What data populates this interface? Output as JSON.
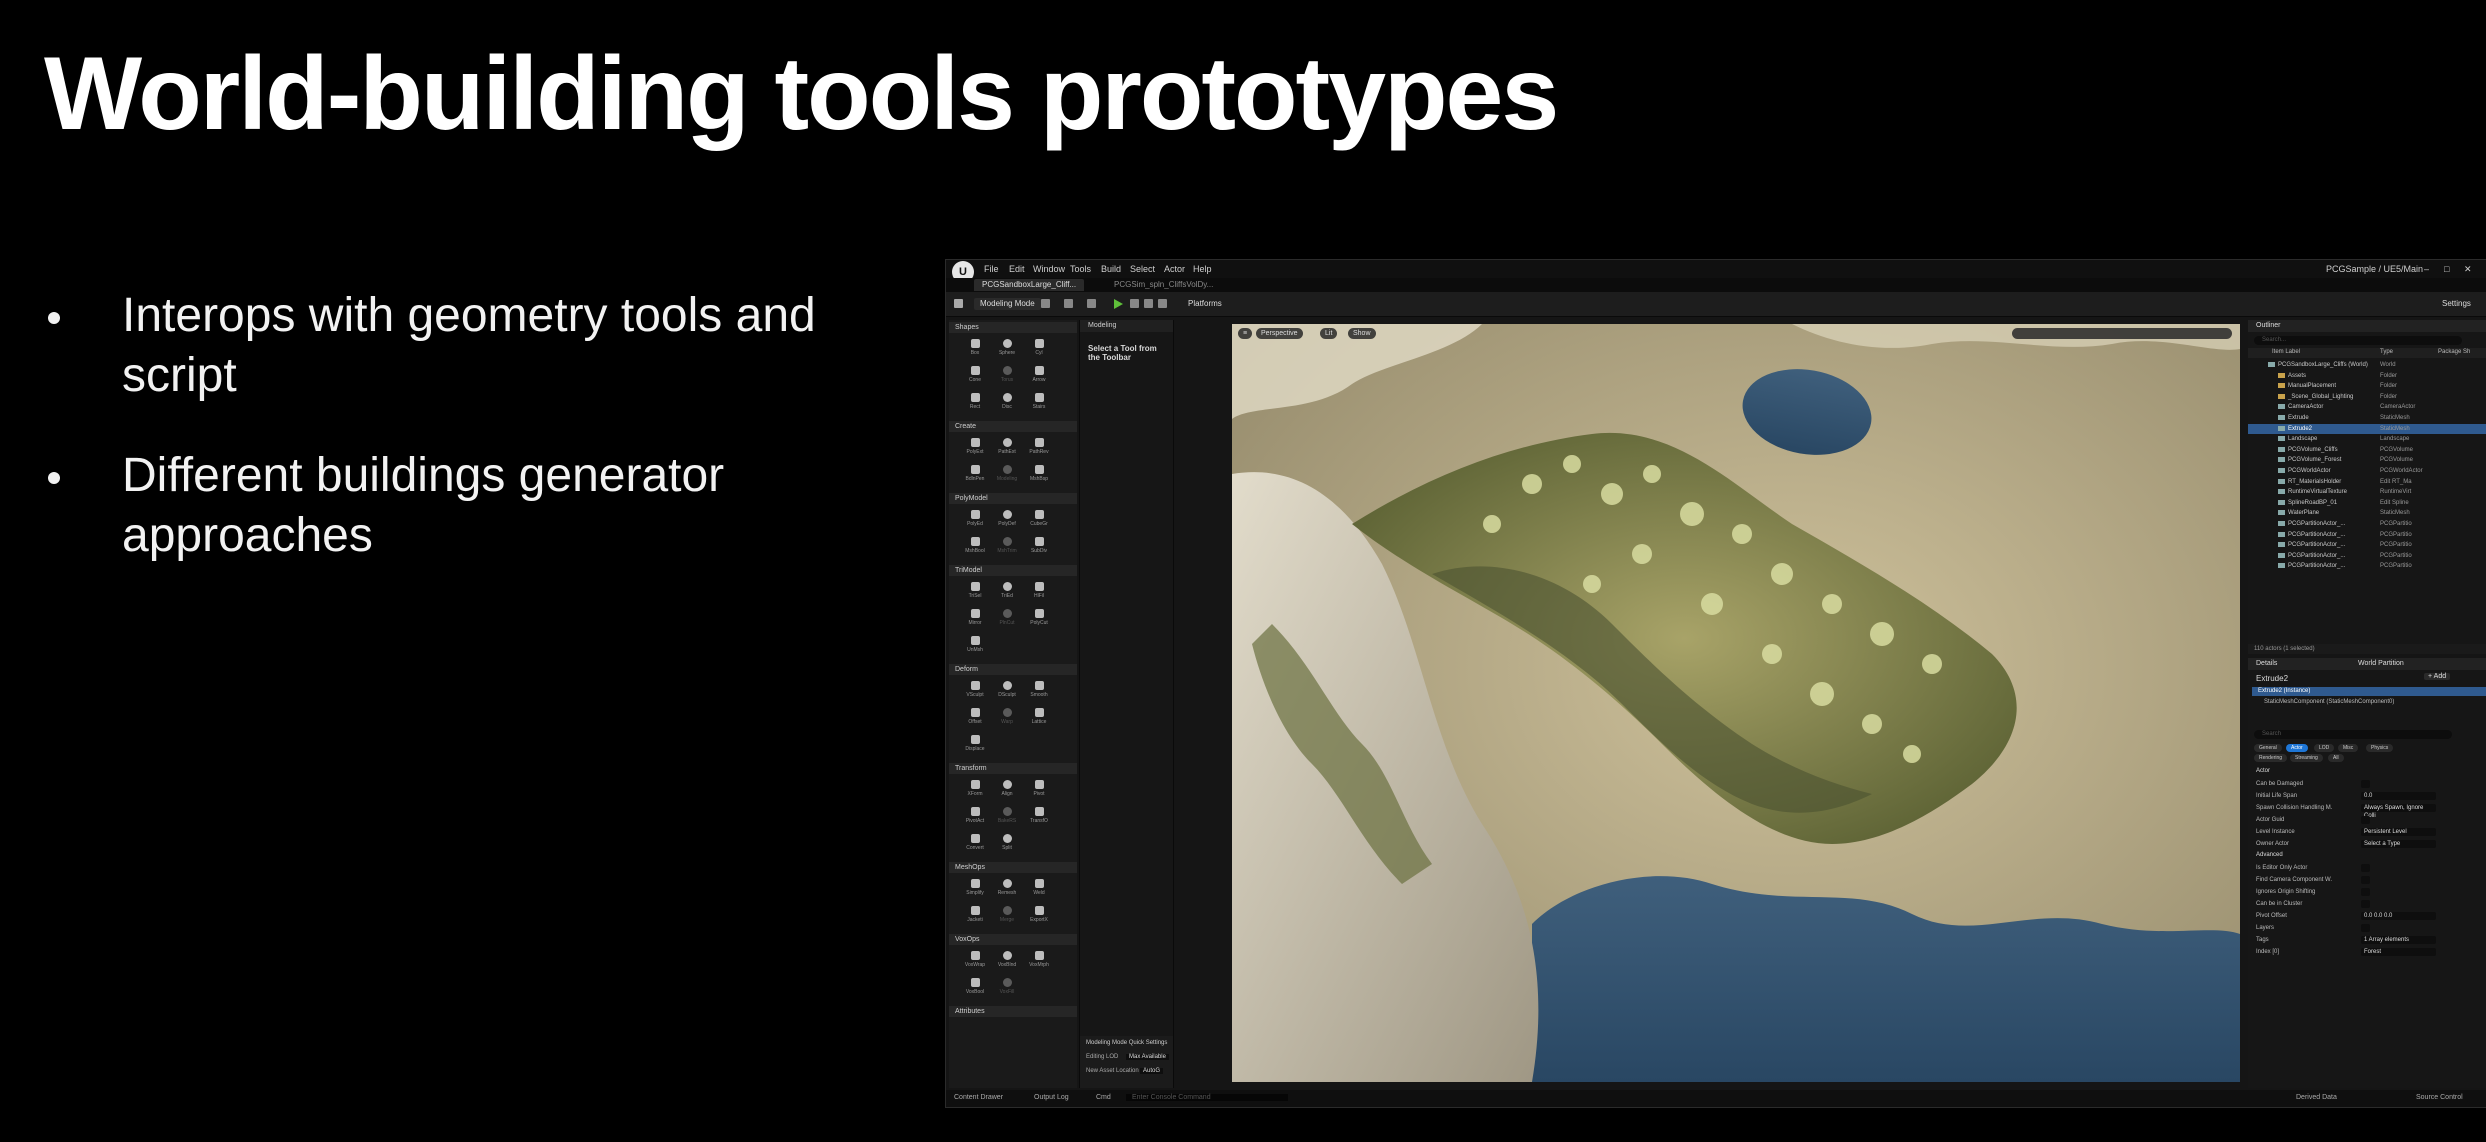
{
  "slide": {
    "title": "World-building tools prototypes",
    "bullets": [
      "Interops with geometry tools and script",
      "Different buildings generator approaches"
    ]
  },
  "editor": {
    "menu": [
      "File",
      "Edit",
      "Window",
      "Tools",
      "Build",
      "Select",
      "Actor",
      "Help"
    ],
    "project_label": "PCGSample / UE5/Main",
    "tabs": [
      "PCGSandboxLarge_Cliff...",
      "PCGSim_spln_CliffsVolDy..."
    ],
    "toolbar": {
      "mode": "Modeling Mode",
      "platforms": "Platforms",
      "settings": "Settings"
    },
    "viewport": {
      "perspective": "Perspective",
      "lit": "Lit",
      "show": "Show"
    },
    "modeling_panel": {
      "title": "Modeling",
      "prompt": "Select a Tool from the Toolbar",
      "quick_settings": "Modeling Mode Quick Settings",
      "editing_lod": "Editing LOD",
      "editing_lod_value": "Max Available",
      "new_asset_location": "New Asset Location",
      "new_asset_location_value": "AutoG"
    },
    "palette": [
      {
        "name": "Shapes",
        "tools": [
          "Box",
          "Sphere",
          "Cyl",
          "Cone",
          "Torus",
          "Arrow",
          "Rect",
          "Disc",
          "Stairs"
        ]
      },
      {
        "name": "Create",
        "tools": [
          "PolyExt",
          "PathExt",
          "PathRev",
          "BdlnPen",
          "Modeling",
          "MshBsp"
        ]
      },
      {
        "name": "PolyModel",
        "tools": [
          "PolyEd",
          "PolyDef",
          "CubeGr",
          "MshBool",
          "MshTrim",
          "SubDiv"
        ]
      },
      {
        "name": "TriModel",
        "tools": [
          "TriSel",
          "TriEd",
          "HlFil",
          "Mirror",
          "PlnCut",
          "PolyCut",
          "UnMsh"
        ]
      },
      {
        "name": "Deform",
        "tools": [
          "VSculpt",
          "DSculpt",
          "Smooth",
          "Offset",
          "Warp",
          "Lattice",
          "Displace"
        ]
      },
      {
        "name": "Transform",
        "tools": [
          "XForm",
          "Align",
          "Pivot",
          "PivotAct",
          "BakeRS",
          "TransfO",
          "Convert",
          "Split"
        ]
      },
      {
        "name": "MeshOps",
        "tools": [
          "Simplify",
          "Remesh",
          "Weld",
          "Jacketi",
          "Merge",
          "ExportX"
        ]
      },
      {
        "name": "VoxOps",
        "tools": [
          "VoxWrap",
          "VoxBlnd",
          "VoxMrph",
          "VoxBool",
          "VoxFill"
        ]
      },
      {
        "name": "Attributes",
        "tools": []
      }
    ],
    "outliner": {
      "title": "Outliner",
      "search_placeholder": "Search...",
      "columns": [
        "Item Label",
        "Type",
        "Package Sh"
      ],
      "rows": [
        {
          "label": "PCGSandboxLarge_Cliffs (World)",
          "type": "World",
          "selected": false
        },
        {
          "label": "Assets",
          "type": "Folder",
          "selected": false
        },
        {
          "label": "ManualPlacement",
          "type": "Folder",
          "selected": false
        },
        {
          "label": "_Scene_Global_Lighting",
          "type": "Folder",
          "selected": false
        },
        {
          "label": "CameraActor",
          "type": "CameraActor",
          "selected": false
        },
        {
          "label": "Extrude",
          "type": "StaticMesh",
          "selected": false
        },
        {
          "label": "Extrude2",
          "type": "StaticMesh",
          "selected": true
        },
        {
          "label": "Landscape",
          "type": "Landscape",
          "selected": false
        },
        {
          "label": "PCGVolume_Cliffs",
          "type": "PCGVolume",
          "selected": false
        },
        {
          "label": "PCGVolume_Forest",
          "type": "PCGVolume",
          "selected": false
        },
        {
          "label": "PCGWorldActor",
          "type": "PCGWorldActor",
          "selected": false
        },
        {
          "label": "RT_MaterialsHolder",
          "type": "Edit RT_Ma",
          "selected": false
        },
        {
          "label": "RuntimeVirtualTexture",
          "type": "RuntimeVirt",
          "selected": false
        },
        {
          "label": "SplineRoadBP_01",
          "type": "Edit Spline",
          "selected": false
        },
        {
          "label": "WaterPlane",
          "type": "StaticMesh",
          "selected": false
        },
        {
          "label": "PCGPartitionActor_...",
          "type": "PCGPartitio",
          "selected": false
        },
        {
          "label": "PCGPartitionActor_...",
          "type": "PCGPartitio",
          "selected": false
        },
        {
          "label": "PCGPartitionActor_...",
          "type": "PCGPartitio",
          "selected": false
        },
        {
          "label": "PCGPartitionActor_...",
          "type": "PCGPartitio",
          "selected": false
        },
        {
          "label": "PCGPartitionActor_...",
          "type": "PCGPartitio",
          "selected": false
        }
      ],
      "footer": "110 actors (1 selected)"
    },
    "details": {
      "tab": "Details",
      "tab2": "World Partition",
      "actor": "Extrude2",
      "add_label": "+ Add",
      "component_root": "Extrude2 (Instance)",
      "component_child": "StaticMeshComponent (StaticMeshComponent0)",
      "search_placeholder": "Search",
      "filters": [
        "General",
        "Actor",
        "LOD",
        "Misc",
        "Physics",
        "Rendering",
        "Streaming",
        "All"
      ],
      "active_filter": "Actor",
      "section_actor": "Actor",
      "section_advanced": "Advanced",
      "properties": [
        {
          "label": "Can be Damaged",
          "value": ""
        },
        {
          "label": "Initial Life Span",
          "value": "0.0"
        },
        {
          "label": "Spawn Collision Handling M.",
          "value": "Always Spawn, Ignore Colli"
        },
        {
          "label": "Actor Guid",
          "value": ""
        },
        {
          "label": "Level Instance",
          "value": "Persistent Level"
        },
        {
          "label": "Owner Actor",
          "value": "Select a Type"
        },
        {
          "label": "Is Editor Only Actor",
          "value": ""
        },
        {
          "label": "Find Camera Component W.",
          "value": ""
        },
        {
          "label": "Ignores Origin Shifting",
          "value": ""
        },
        {
          "label": "Can be in Cluster",
          "value": ""
        },
        {
          "label": "Pivot Offset",
          "value": "0.0   0.0   0.0"
        },
        {
          "label": "Layers",
          "value": ""
        },
        {
          "label": "Tags",
          "value": "1 Array elements"
        },
        {
          "label": "Index [0]",
          "value": "Forest"
        }
      ]
    },
    "status_bar": {
      "content_drawer": "Content Drawer",
      "output_log": "Output Log",
      "cmd": "Cmd",
      "console_placeholder": "Enter Console Command",
      "derived_data": "Derived Data",
      "source_control": "Source Control"
    }
  }
}
